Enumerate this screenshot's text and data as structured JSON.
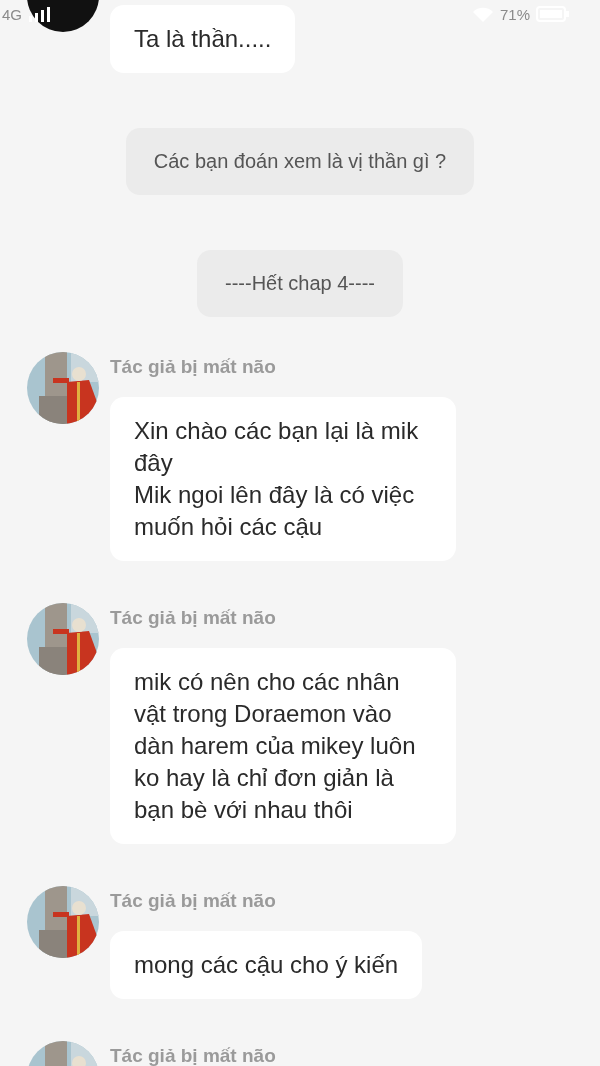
{
  "status_bar": {
    "network": "4G",
    "battery": "71%"
  },
  "messages": [
    {
      "kind": "incoming",
      "avatar": {
        "kind": "plain"
      },
      "text": "Ta là thần....."
    },
    {
      "kind": "system",
      "text": "Các bạn đoán xem là vị thần gì ?"
    },
    {
      "kind": "system",
      "text": "----Hết chap 4----"
    },
    {
      "kind": "incoming",
      "sender": "Tác giả bị mất não",
      "text": "Xin chào các bạn lại là mik đây\nMik ngoi lên đây là có việc muốn hỏi các cậu"
    },
    {
      "kind": "incoming",
      "sender": "Tác giả bị mất não",
      "text": "mik có nên cho các nhân vật trong Doraemon vào dàn harem của mikey luôn ko hay là chỉ đơn giản là bạn  bè với nhau thôi"
    },
    {
      "kind": "incoming",
      "sender": "Tác giả bị mất não",
      "text": "mong các cậu cho ý kiến"
    },
    {
      "kind": "incoming",
      "sender": "Tác giả bị mất não"
    }
  ]
}
